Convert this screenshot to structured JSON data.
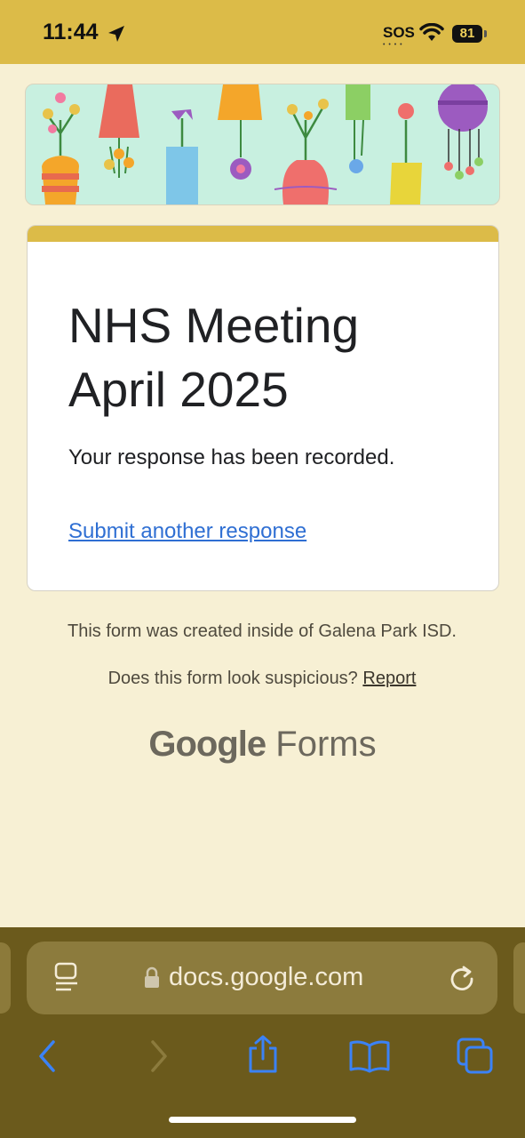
{
  "status_bar": {
    "time": "11:44",
    "sos": "SOS",
    "battery": "81"
  },
  "form": {
    "title": "NHS Meeting April 2025",
    "confirmation": "Your response has been recorded.",
    "submit_another": "Submit another response"
  },
  "footer": {
    "created_inside": "This form was created inside of Galena Park ISD.",
    "suspicious_question": "Does this form look suspicious?",
    "report_link": "Report",
    "brand_google": "Google",
    "brand_forms": "Forms"
  },
  "browser": {
    "url": "docs.google.com"
  },
  "colors": {
    "theme": "#dcbb48",
    "page_background": "#f7f0d4",
    "link": "#2f6fd3",
    "toolbar": "#6b5a1c"
  },
  "icons": [
    "location-arrow-icon",
    "wifi-icon",
    "battery-icon",
    "reader-icon",
    "lock-icon",
    "reload-icon",
    "back-icon",
    "forward-icon",
    "share-icon",
    "bookmarks-icon",
    "tabs-icon"
  ]
}
